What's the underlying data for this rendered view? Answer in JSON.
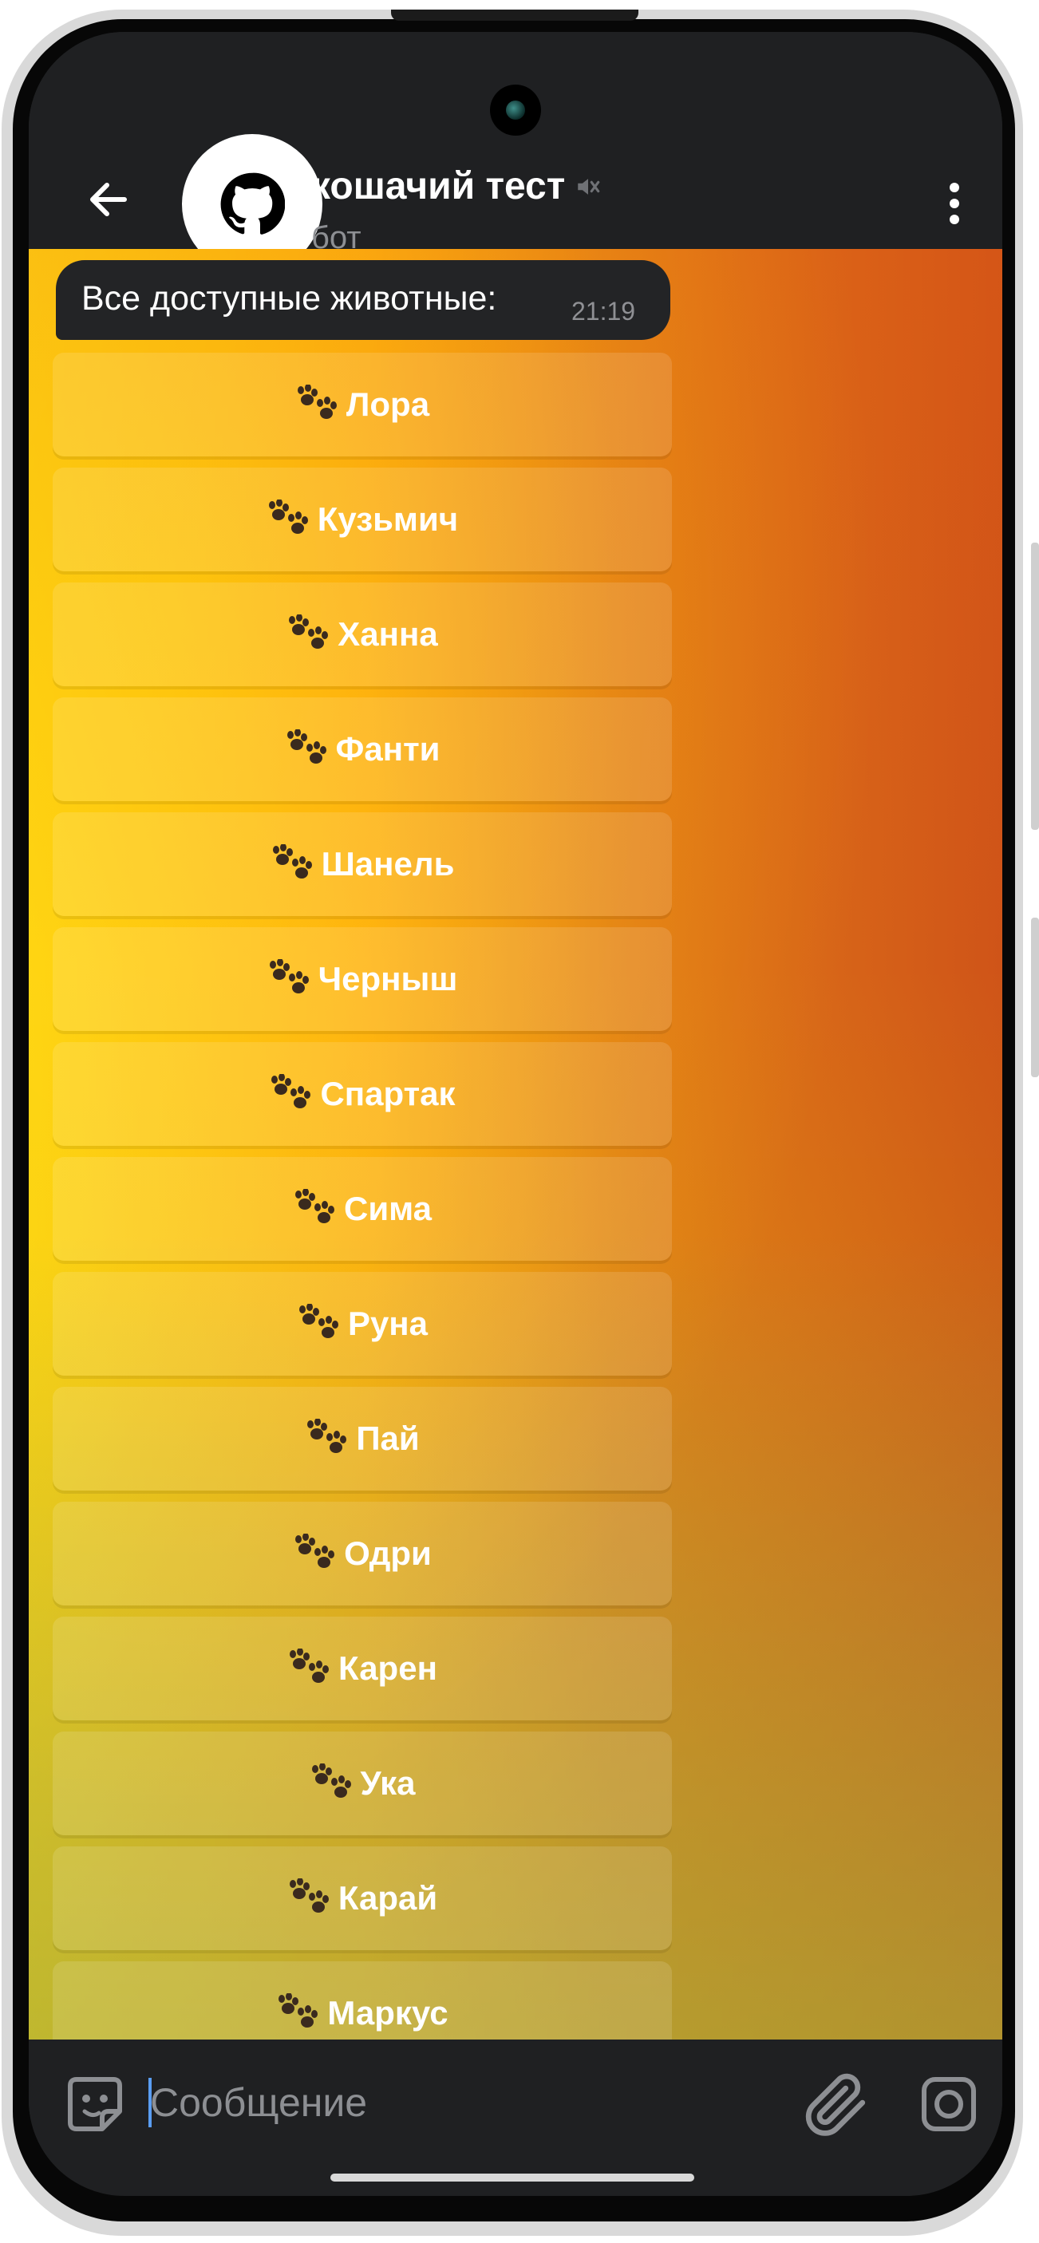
{
  "header": {
    "title": "кошачий тест",
    "subtitle": "бот"
  },
  "message": {
    "text": "Все доступные животные:",
    "time": "21:19"
  },
  "keyboard": [
    {
      "label": "Лора"
    },
    {
      "label": "Кузьмич"
    },
    {
      "label": "Ханна"
    },
    {
      "label": "Фанти"
    },
    {
      "label": "Шанель"
    },
    {
      "label": "Черныш"
    },
    {
      "label": "Спартак"
    },
    {
      "label": "Сима"
    },
    {
      "label": "Руна"
    },
    {
      "label": "Пай"
    },
    {
      "label": "Одри"
    },
    {
      "label": "Карен"
    },
    {
      "label": "Ука"
    },
    {
      "label": "Карай"
    },
    {
      "label": "Маркус"
    }
  ],
  "input": {
    "placeholder": "Сообщение"
  },
  "colors": {
    "header_bg": "#1f2022",
    "bubble_bg": "#232426",
    "accent_cursor": "#5a9df2"
  },
  "icons": {
    "back": "arrow-left-icon",
    "avatar": "github-icon",
    "mute": "muted-speaker-icon",
    "menu": "more-vertical-icon",
    "button": "paw-prints-icon",
    "sticker": "sticker-icon",
    "attach": "paperclip-icon",
    "camera": "camera-icon"
  }
}
